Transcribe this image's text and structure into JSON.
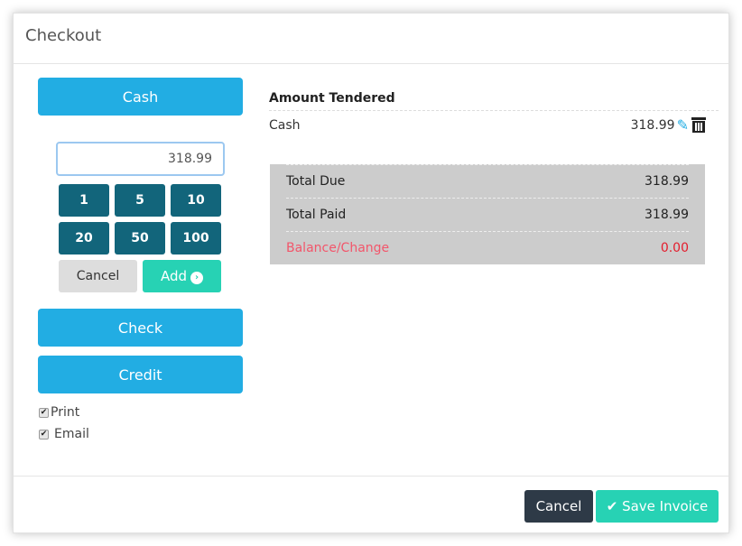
{
  "modal": {
    "title": "Checkout"
  },
  "payment_methods": {
    "cash": "Cash",
    "check": "Check",
    "credit": "Credit"
  },
  "amount_input": {
    "value": "318.99"
  },
  "denominations": [
    "1",
    "5",
    "10",
    "20",
    "50",
    "100"
  ],
  "keypad": {
    "cancel": "Cancel",
    "add": "Add",
    "add_icon": "›"
  },
  "options": {
    "print": "Print",
    "email": "Email",
    "print_checked": true,
    "email_checked": true,
    "check_glyph": "✔"
  },
  "tendered": {
    "heading": "Amount Tendered",
    "rows": [
      {
        "method": "Cash",
        "amount": "318.99",
        "edit_icon": "✎"
      }
    ]
  },
  "totals": {
    "rows": [
      {
        "label": "Total Due",
        "value": "318.99"
      },
      {
        "label": "Total Paid",
        "value": "318.99"
      },
      {
        "label": "Balance/Change",
        "value": "0.00"
      }
    ]
  },
  "footer": {
    "cancel": "Cancel",
    "save": "Save Invoice",
    "save_icon": "✔"
  },
  "colors": {
    "primary": "#22ade3",
    "denomination": "#12657b",
    "success": "#27d2b4",
    "dark": "#2e3a47",
    "danger": "#e41c2c"
  }
}
